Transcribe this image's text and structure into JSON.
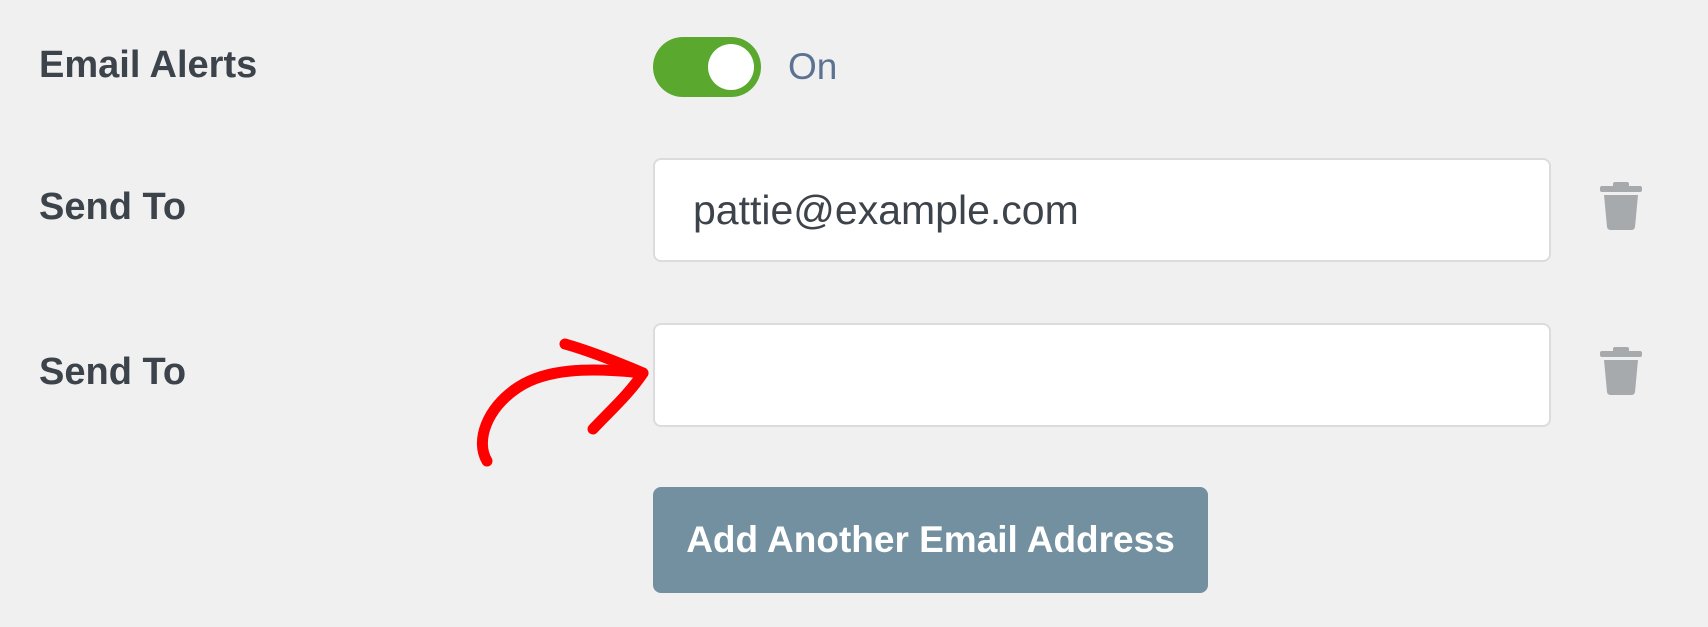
{
  "email_alerts": {
    "label": "Email Alerts",
    "toggle_on": true,
    "toggle_state_text": "On"
  },
  "recipients": [
    {
      "label": "Send To",
      "value": "pattie@example.com",
      "placeholder": ""
    },
    {
      "label": "Send To",
      "value": "",
      "placeholder": ""
    }
  ],
  "add_button_label": "Add Another Email Address",
  "icons": {
    "delete": "trash-icon",
    "annotation": "red-arrow-annotation"
  },
  "colors": {
    "background": "#f0f0f1",
    "toggle_on": "#5ba82f",
    "toggle_state_text": "#5b7291",
    "label_text": "#3c434a",
    "button_bg": "#7390a1",
    "trash_icon": "#a7aaad",
    "annotation": "#ff0000"
  }
}
